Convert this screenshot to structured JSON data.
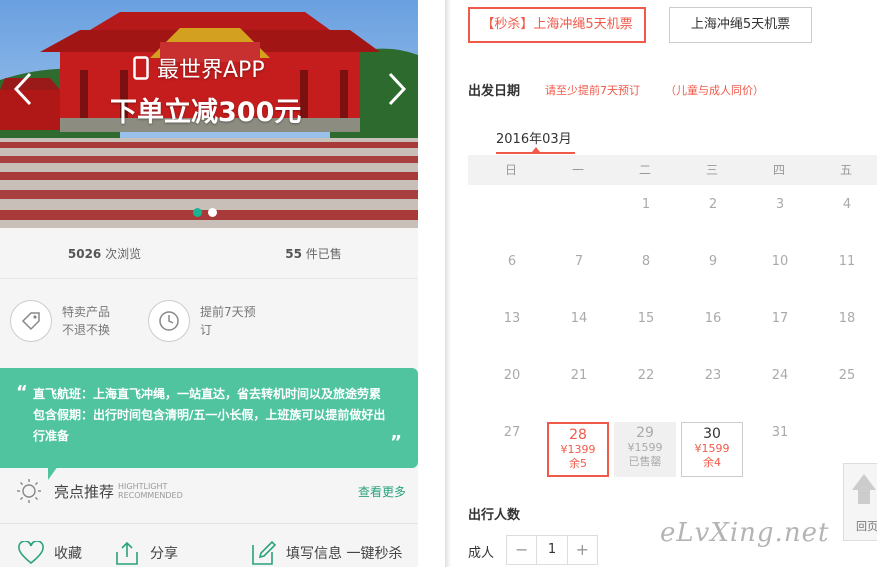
{
  "hero": {
    "line1": "最世界APP",
    "line2": "下单立减300元",
    "icons": {
      "prev": "chevron-left-icon",
      "next": "chevron-right-icon",
      "phone": "phone-icon"
    }
  },
  "stats": {
    "views_count": "5026",
    "views_label": "次浏览",
    "sold_count": "55",
    "sold_label": "件已售"
  },
  "features": [
    {
      "icon": "tag-icon",
      "text": "特卖产品不退不换"
    },
    {
      "icon": "clock-icon",
      "text": "提前7天预订"
    }
  ],
  "highlight_box": {
    "line1": "直飞航班：上海直飞冲绳，一站直达，省去转机时间以及旅途劳累",
    "line2": "包含假期：出行时间包含清明/五一小长假，上班族可以提前做好出行准备",
    "colors": {
      "bg": "#4fc49f"
    }
  },
  "highlights": {
    "title": "亮点推荐",
    "sub1": "HIGHTLIGHT",
    "sub2": "RECOMMENDED",
    "more": "查看更多"
  },
  "actions": {
    "favorite": "收藏",
    "share": "分享",
    "fill_info": "填写信息 一键秒杀"
  },
  "tabs": [
    {
      "label": "【秒杀】上海冲绳5天机票",
      "active": true
    },
    {
      "label": "上海冲绳5天机票",
      "active": false
    }
  ],
  "booking": {
    "depart_label": "出发日期",
    "note_advance": "请至少提前7天预订",
    "note_child": "（儿童与成人同价）",
    "month": "2016年03月"
  },
  "calendar": {
    "weekdays": [
      "日",
      "一",
      "二",
      "三",
      "四",
      "五"
    ],
    "rows": [
      [
        "",
        "",
        "1",
        "2",
        "3",
        "4"
      ],
      [
        "6",
        "7",
        "8",
        "9",
        "10",
        "11"
      ],
      [
        "13",
        "14",
        "15",
        "16",
        "17",
        "18"
      ],
      [
        "20",
        "21",
        "22",
        "23",
        "24",
        "25"
      ]
    ],
    "last_row": {
      "d27": "27",
      "d28": {
        "day": "28",
        "price": "¥1399",
        "status": "余5"
      },
      "d29": {
        "day": "29",
        "price": "¥1599",
        "status": "已售罄"
      },
      "d30": {
        "day": "30",
        "price": "¥1599",
        "status": "余4"
      },
      "d31": "31"
    }
  },
  "passengers": {
    "title": "出行人数",
    "adult_label": "成人",
    "adult_count": "1",
    "minus": "−",
    "plus": "+"
  },
  "float_button": {
    "label": "回页",
    "icon": "arrow-up-icon"
  },
  "watermark": "eLvXing.net",
  "colors": {
    "accent": "#f05a4a",
    "green": "#1ab394"
  }
}
